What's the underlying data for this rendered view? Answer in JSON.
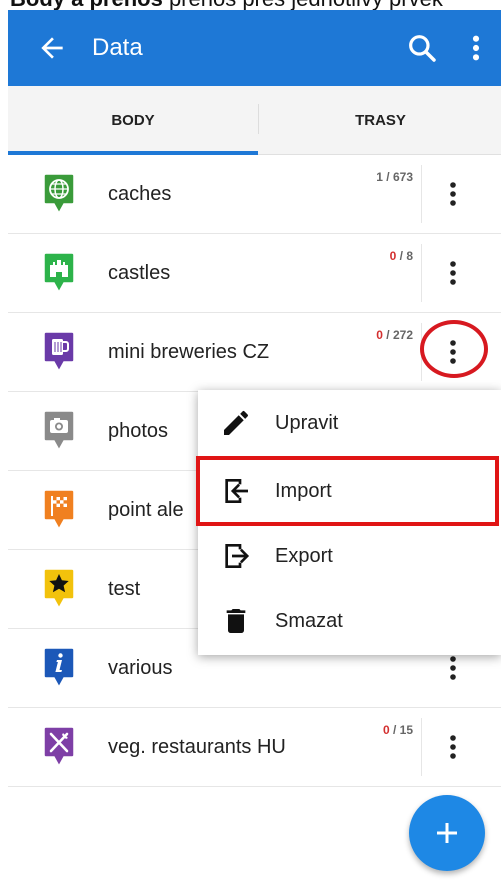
{
  "top_crop": {
    "text_bold": "Body a přenos",
    "text_rest": "přenos přes jednotlivý prvek"
  },
  "appbar": {
    "title": "Data",
    "color": "#1e78d6"
  },
  "tabs": [
    {
      "label": "BODY",
      "active": true
    },
    {
      "label": "TRASY",
      "active": false
    }
  ],
  "list": [
    {
      "name": "caches",
      "count_visible": "1",
      "count_total": " / 673",
      "icon": "globe-icon",
      "color": "#3a9b3a"
    },
    {
      "name": "castles",
      "count_visible": "0",
      "count_total": " / 8",
      "icon": "castle-icon",
      "color": "#2db34a"
    },
    {
      "name": "mini breweries CZ",
      "count_visible": "0",
      "count_total": " / 272",
      "icon": "beer-mug-icon",
      "color": "#6a3aa8"
    },
    {
      "name": "photos",
      "count_visible": "",
      "count_total": "",
      "icon": "camera-icon",
      "color": "#8a8a8a"
    },
    {
      "name": "point ale",
      "count_visible": "",
      "count_total": "",
      "icon": "checkered-flag-icon",
      "color": "#f08020"
    },
    {
      "name": "test",
      "count_visible": "",
      "count_total": "",
      "icon": "star-icon",
      "color": "#f2c20c"
    },
    {
      "name": "various",
      "count_visible": "",
      "count_total": "",
      "icon": "info-icon",
      "color": "#1c58b8"
    },
    {
      "name": "veg. restaurants HU",
      "count_visible": "0",
      "count_total": " / 15",
      "icon": "fork-knife-icon",
      "color": "#7e3fa6"
    }
  ],
  "menu": [
    {
      "label": "Upravit",
      "icon": "pencil-icon"
    },
    {
      "label": "Import",
      "icon": "import-icon"
    },
    {
      "label": "Export",
      "icon": "export-icon"
    },
    {
      "label": "Smazat",
      "icon": "trash-icon"
    }
  ],
  "fab": {
    "label": "+"
  }
}
